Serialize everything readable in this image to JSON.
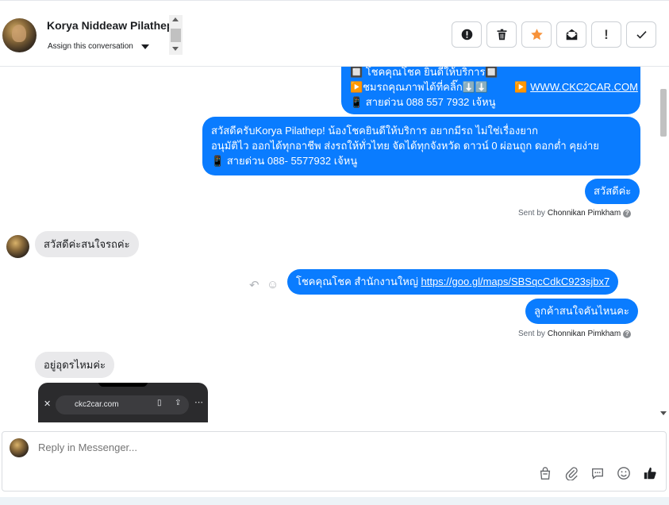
{
  "header": {
    "contact_name": "Korya Niddeaw Pilathep",
    "assign_label": "Assign this conversation",
    "actions": [
      {
        "name": "spam-button",
        "icon": "alert-circle-icon"
      },
      {
        "name": "delete-button",
        "icon": "trash-icon"
      },
      {
        "name": "star-button",
        "icon": "star-icon",
        "color": "#f7923a"
      },
      {
        "name": "mark-unread-button",
        "icon": "envelope-icon"
      },
      {
        "name": "follow-up-button",
        "icon": "exclamation-icon",
        "label": "!"
      },
      {
        "name": "done-button",
        "icon": "check-icon",
        "label": "✓"
      }
    ]
  },
  "messages": {
    "m1_line1": "🔲 โชคคุณโชค ยินดีให้บริการ🔲",
    "m1_line2a": "▶️ชมรถคุณภาพได้ที่คลิ๊ก⬇️⬇️",
    "m1_line2b_prefix": "▶️",
    "m1_link": "WWW.CKC2CAR.COM",
    "m1_line3": "📱 สายด่วน 088 557 7932 เจ้หนู",
    "m2_line1": "สวัสดีครับKorya Pilathep! น้องโชคยินดีให้บริการ อยากมีรถ ไม่ใช่เรื่องยาก",
    "m2_line2": "อนุมัติไว ออกได้ทุกอาชีพ ส่งรถให้ทั่วไทย จัดได้ทุกจังหวัด ดาวน์ 0  ผ่อนถูก ดอกต่ำ คุยง่าย",
    "m2_line3": "📱 สายด่วน 088- 5577932 เจ้หนู",
    "m3": "สวัสดีค่ะ",
    "sent_by_prefix": "Sent by",
    "sent_by_name": "Chonnikan Pimkham",
    "m4_in": "สวัสดีค่ะสนใจรถค่ะ",
    "m5_prefix": "โชคคุณโชค สำนักงานใหญ่ ",
    "m5_link": "https://goo.gl/maps/SBSqcCdkC923sjbx7",
    "m6": "ลูกค้าสนใจคันไหนคะ",
    "sent_by2_prefix": "Sent by",
    "sent_by2_name": "Chonnikan Pimkham",
    "m7_in": "อยู่อุดรไหมค่ะ",
    "attachment_url": "ckc2car.com"
  },
  "composer": {
    "placeholder": "Reply in Messenger..."
  }
}
